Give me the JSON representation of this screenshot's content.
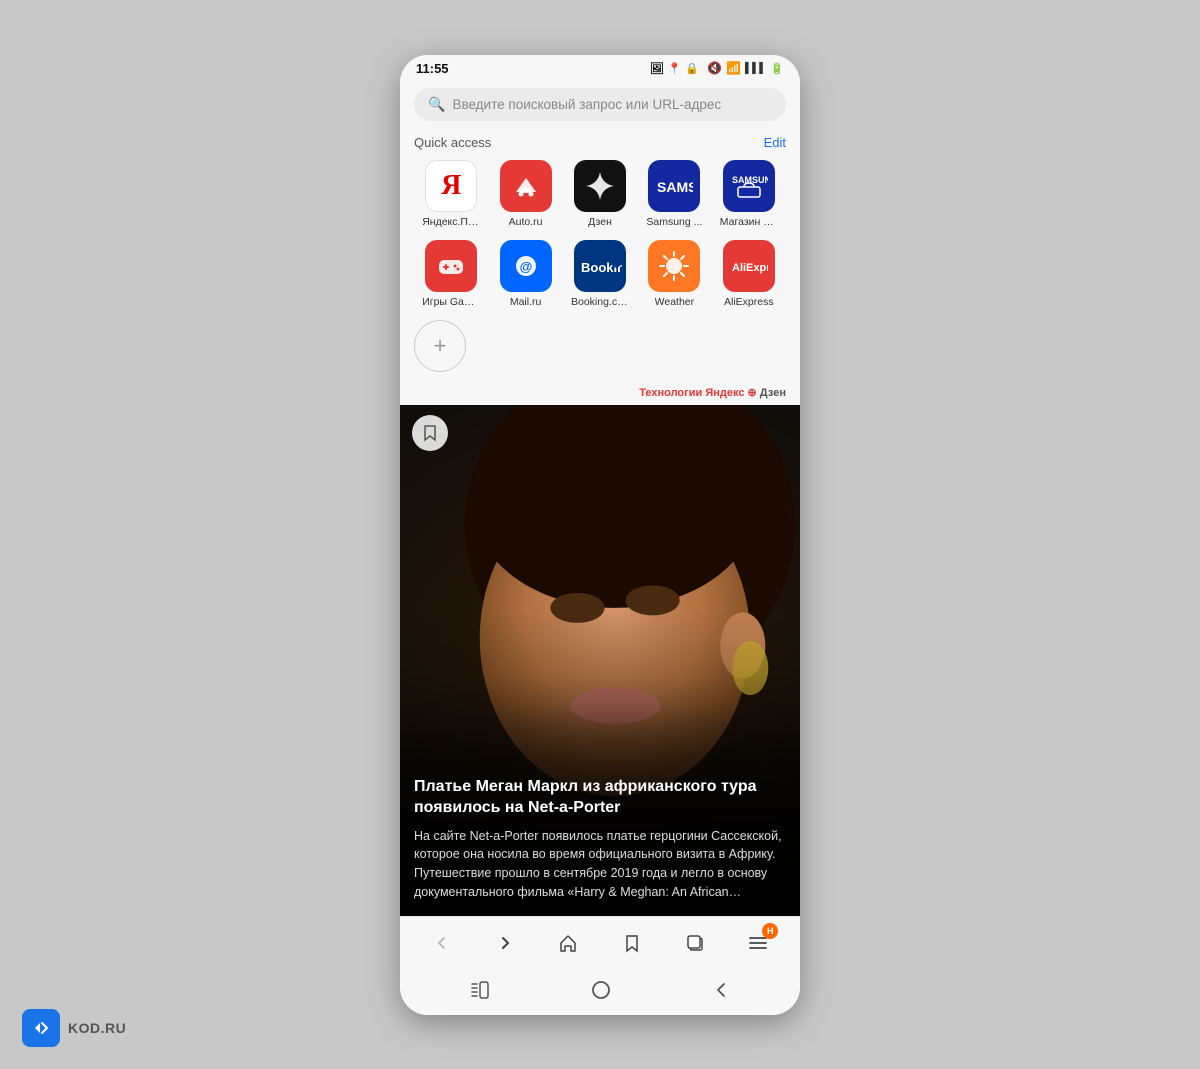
{
  "statusBar": {
    "time": "11:55",
    "icons": [
      "📷",
      "📍",
      "🔒"
    ]
  },
  "searchBar": {
    "placeholder": "Введите поисковый запрос или URL-адрес"
  },
  "quickAccess": {
    "label": "Quick access",
    "editLabel": "Edit",
    "apps": [
      {
        "id": "yandex",
        "label": "Яндекс.По...",
        "iconType": "yandex"
      },
      {
        "id": "autoru",
        "label": "Auto.ru",
        "iconType": "autoru"
      },
      {
        "id": "dzen",
        "label": "Дзен",
        "iconType": "dzen"
      },
      {
        "id": "samsung",
        "label": "Samsung ...",
        "iconType": "samsung"
      },
      {
        "id": "samsung2",
        "label": "Магазин С...",
        "iconType": "samsung2"
      },
      {
        "id": "games",
        "label": "Игры Gam...",
        "iconType": "games"
      },
      {
        "id": "mailru",
        "label": "Mail.ru",
        "iconType": "mailru"
      },
      {
        "id": "booking",
        "label": "Booking.com",
        "iconType": "booking"
      },
      {
        "id": "weather",
        "label": "Weather",
        "iconType": "weather"
      },
      {
        "id": "aliexpress",
        "label": "AliExpress",
        "iconType": "aliexpress"
      }
    ],
    "addLabel": "+"
  },
  "zenAttr": {
    "text": "Технологии Яндекс",
    "zen": "Дзен"
  },
  "newsCard": {
    "title": "Платье Меган Маркл из африканского тура появилось на Net-a-Porter",
    "body": "На сайте Net-a-Porter появилось платье герцогини Сассекской, которое она носила во время официального визита в Африку. Путешествие прошло в сентябре 2019 года и легло в основу документального фильма «Harry & Meghan: An African Journey». Тогда Меган Маркл надевала несколько..."
  },
  "browserNav": {
    "back": "‹",
    "forward": "›",
    "home": "⌂",
    "bookmark": "☆",
    "tabs": "⧉",
    "menu": "☰",
    "badgeCount": "H"
  },
  "androidNav": {
    "back": "◁",
    "home": "○",
    "recent": "▷"
  },
  "watermark": {
    "text": "KOD.RU"
  }
}
